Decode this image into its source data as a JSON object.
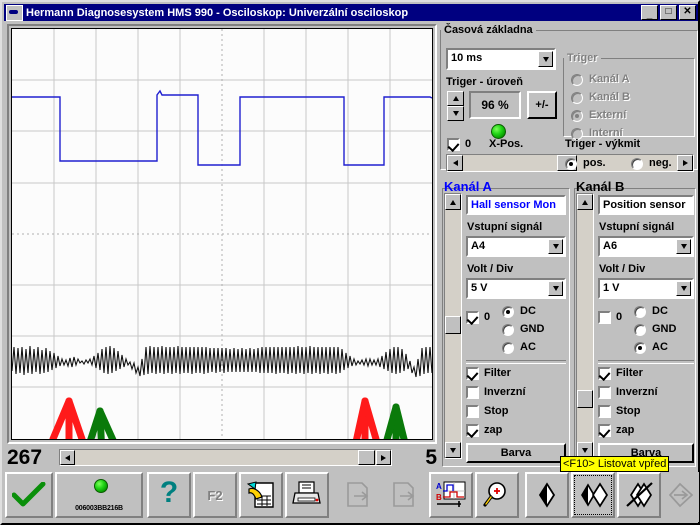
{
  "window": {
    "title": "Hermann Diagnosesystem HMS 990 - Osciloskop: Univerzální osciloskop",
    "icon": "oscilloscope-icon",
    "minimize_label": "_",
    "maximize_label": "□",
    "close_label": "✕"
  },
  "scope": {
    "grid_cols": 10,
    "grid_rows": 8,
    "position_left": "267",
    "position_right": "5",
    "scroll_left_arrow": "◄",
    "scroll_right_arrow": "►"
  },
  "timebase": {
    "group_label": "Časová základna",
    "timebase_value": "10 ms",
    "trigger_level_label": "Triger - úroveň",
    "trigger_level_value": "96 %",
    "plusminus_label": "+/-",
    "led_state": "green",
    "zero_checkbox_label": "0",
    "zero_checked": true,
    "xpos_label": "X-Pos.",
    "spin_up": "▲",
    "spin_down": "▼"
  },
  "trigger": {
    "group_label": "Triger",
    "disabled": true,
    "options": [
      {
        "label": "Kanál A",
        "selected": false
      },
      {
        "label": "Kanál B",
        "selected": false
      },
      {
        "label": "Externí",
        "selected": true
      },
      {
        "label": "Interní",
        "selected": false
      }
    ],
    "slope_label": "Triger - výkmit",
    "slope_options": [
      {
        "label": "pos.",
        "selected": true
      },
      {
        "label": "neg.",
        "selected": false
      }
    ]
  },
  "channel_a": {
    "title": "Kanál A",
    "title_color": "#0000ff",
    "sensor_name": "Hall sensor Mon",
    "sensor_name_color": "#0000ff",
    "input_label": "Vstupní signál",
    "input_value": "A4",
    "voltdiv_label": "Volt / Div",
    "voltdiv_value": "5 V",
    "zero_label": "0",
    "zero_checked": true,
    "coupling": [
      {
        "label": "DC",
        "selected": true
      },
      {
        "label": "GND",
        "selected": false
      },
      {
        "label": "AC",
        "selected": false
      }
    ],
    "checks": [
      {
        "label": "Filter",
        "checked": true
      },
      {
        "label": "Inverzní",
        "checked": false
      },
      {
        "label": "Stop",
        "checked": false
      },
      {
        "label": "zap",
        "checked": true
      }
    ],
    "color_button": "Barva"
  },
  "channel_b": {
    "title": "Kanál B",
    "title_color": "#000000",
    "sensor_name": "Position sensor",
    "sensor_name_color": "#000000",
    "input_label": "Vstupní signál",
    "input_value": "A6",
    "voltdiv_label": "Volt / Div",
    "voltdiv_value": "1 V",
    "zero_label": "0",
    "zero_checked": false,
    "coupling": [
      {
        "label": "DC",
        "selected": false
      },
      {
        "label": "GND",
        "selected": false
      },
      {
        "label": "AC",
        "selected": true
      }
    ],
    "checks": [
      {
        "label": "Filter",
        "checked": true
      },
      {
        "label": "Inverzní",
        "checked": false
      },
      {
        "label": "Stop",
        "checked": false
      },
      {
        "label": "zap",
        "checked": true
      }
    ],
    "color_button": "Barva"
  },
  "tooltip": {
    "text": "<F10> Listovat vpřed"
  },
  "toolbar": {
    "ok_label": "check-icon",
    "dongle_serial": "006003BB216B",
    "help_label": "?",
    "f2_label": "F2",
    "edit_label": "edit-table-icon",
    "print_label": "printer-icon",
    "export1_label": "export-page-icon",
    "export2_label": "export-page-icon",
    "ab_label": "channel-ab-icon",
    "zoom_label": "zoom-in-icon",
    "prev_label": "previous-icon",
    "next_label": "next-icon",
    "delete_label": "delete-icon",
    "forward_label": "forward-icon"
  },
  "chart_data": {
    "type": "line",
    "title": "Univerzální osciloskop",
    "xlabel": "",
    "ylabel": "",
    "grid": true,
    "grid_cols": 10,
    "grid_rows": 8,
    "timebase_per_div": "10 ms",
    "series": [
      {
        "name": "Kanál A - Hall sensor Mon",
        "color": "#0000cc",
        "volts_per_div": "5 V",
        "type": "square",
        "description": "Digital Hall-sensor square wave, high/low transitions",
        "transitions_x_pct": [
          0,
          11.6,
          37.5,
          45.5,
          57.0,
          85.5,
          93.5,
          100
        ],
        "levels": [
          1,
          0,
          1,
          0,
          1,
          0,
          1
        ]
      },
      {
        "name": "Kanál B - Position sensor",
        "color": "#000000",
        "volts_per_div": "1 V",
        "type": "oscillation",
        "description": "High-frequency AC oscillation with two amplitude-drop events"
      }
    ],
    "annotations": [
      {
        "kind": "arrow",
        "color": "#ff1a1a",
        "label": "red-marker-1",
        "x_pct": 13.5
      },
      {
        "kind": "arrow",
        "color": "#0a7a0a",
        "label": "green-marker-1",
        "x_pct": 20.5
      },
      {
        "kind": "arrow",
        "color": "#ff1a1a",
        "label": "red-marker-2",
        "x_pct": 84.0
      },
      {
        "kind": "arrow",
        "color": "#0a7a0a",
        "label": "green-marker-2",
        "x_pct": 91.0
      }
    ]
  }
}
